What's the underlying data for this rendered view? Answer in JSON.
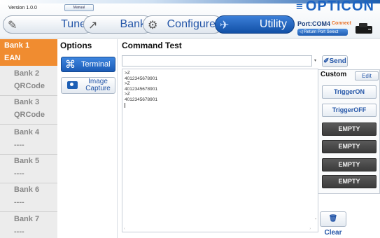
{
  "header": {
    "version": "Version 1.0.0",
    "manual_label": "Manual",
    "brand": "OPTICON",
    "brand_menu_icon": "≡",
    "tabs": [
      {
        "label": "Tune",
        "icon": "tuner-icon",
        "glyph": "✎"
      },
      {
        "label": "Bank",
        "icon": "bank-icon",
        "glyph": "↗"
      },
      {
        "label": "Configure",
        "icon": "gear-icon",
        "glyph": "⚙"
      },
      {
        "label": "Utility",
        "icon": "utility-icon",
        "glyph": "✈"
      }
    ],
    "active_tab": "Utility",
    "port_label": "Port:COM4",
    "port_status": "Connect",
    "return_label": "Return Port Select"
  },
  "banks": [
    {
      "name": "Bank 1",
      "code": "EAN",
      "active": true
    },
    {
      "name": "Bank 2",
      "code": "QRCode",
      "active": false
    },
    {
      "name": "Bank 3",
      "code": "QRCode",
      "active": false
    },
    {
      "name": "Bank 4",
      "code": "----",
      "active": false
    },
    {
      "name": "Bank 5",
      "code": "----",
      "active": false
    },
    {
      "name": "Bank 6",
      "code": "----",
      "active": false
    },
    {
      "name": "Bank 7",
      "code": "----",
      "active": false
    }
  ],
  "options": {
    "title": "Options",
    "terminal_label": "Terminal",
    "terminal_glyph": "⌘",
    "image_capture_label": "Image Capture"
  },
  "command": {
    "title": "Command Test",
    "input_value": "",
    "send_label": "Send",
    "output_lines": [
      ">Z",
      "4012345678901",
      ">Z",
      "4012345678901",
      ">Z",
      "4012345678901"
    ]
  },
  "custom": {
    "title": "Custom",
    "edit_label": "Edit",
    "buttons": [
      {
        "label": "TriggerON",
        "style": "light"
      },
      {
        "label": "TriggerOFF",
        "style": "light"
      },
      {
        "label": "EMPTY",
        "style": "dark"
      },
      {
        "label": "EMPTY",
        "style": "dark"
      },
      {
        "label": "EMPTY",
        "style": "dark"
      },
      {
        "label": "EMPTY",
        "style": "dark"
      }
    ]
  },
  "clear_label": "Clear",
  "colors": {
    "brand": "#1d63c2",
    "active_bank": "#f08c30",
    "connect": "#e8732b",
    "custom_dark": "#454545"
  }
}
